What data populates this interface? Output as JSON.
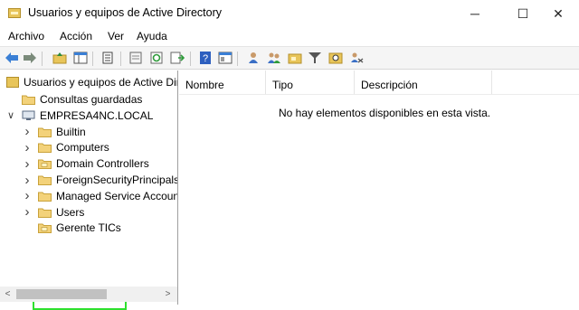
{
  "window": {
    "title": "Usuarios y equipos de Active Directory",
    "minimize_glyph": "─",
    "maximize_glyph": "☐",
    "close_glyph": "✕"
  },
  "menu": [
    "Archivo",
    "Acción",
    "Ver",
    "Ayuda"
  ],
  "toolbar": {
    "icons": [
      "back-arrow-icon",
      "forward-arrow-icon",
      "up-folder-icon",
      "show-hide-tree-icon",
      "console-icon",
      "properties-icon",
      "refresh-icon",
      "export-list-icon",
      "help-icon",
      "properties-sheet-icon",
      "add-user-icon",
      "add-group-icon",
      "new-ou-icon",
      "filter-icon",
      "find-icon",
      "move-icon"
    ]
  },
  "tree": {
    "root": "Usuarios y equipos de Active Directory",
    "items": [
      {
        "label": "Consultas guardadas",
        "expander": "",
        "level": 1
      },
      {
        "label": "EMPRESA4NC.LOCAL",
        "expander": "down",
        "level": 1
      },
      {
        "label": "Builtin",
        "expander": "right",
        "level": 2
      },
      {
        "label": "Computers",
        "expander": "right",
        "level": 2
      },
      {
        "label": "Domain Controllers",
        "expander": "right",
        "level": 2
      },
      {
        "label": "ForeignSecurityPrincipals",
        "expander": "right",
        "level": 2
      },
      {
        "label": "Managed Service Accounts",
        "expander": "right",
        "level": 2
      },
      {
        "label": "Users",
        "expander": "right",
        "level": 2
      },
      {
        "label": "Gerente TICs",
        "expander": "",
        "level": 2
      }
    ],
    "highlighted_item": "Gerente TICs",
    "highlight_color": "#2ee02e"
  },
  "list": {
    "columns": [
      "Nombre",
      "Tipo",
      "Descripción"
    ],
    "empty_message": "No hay elementos disponibles en esta vista."
  },
  "scrollbar": {
    "left_arrow": "<",
    "right_arrow": ">"
  }
}
